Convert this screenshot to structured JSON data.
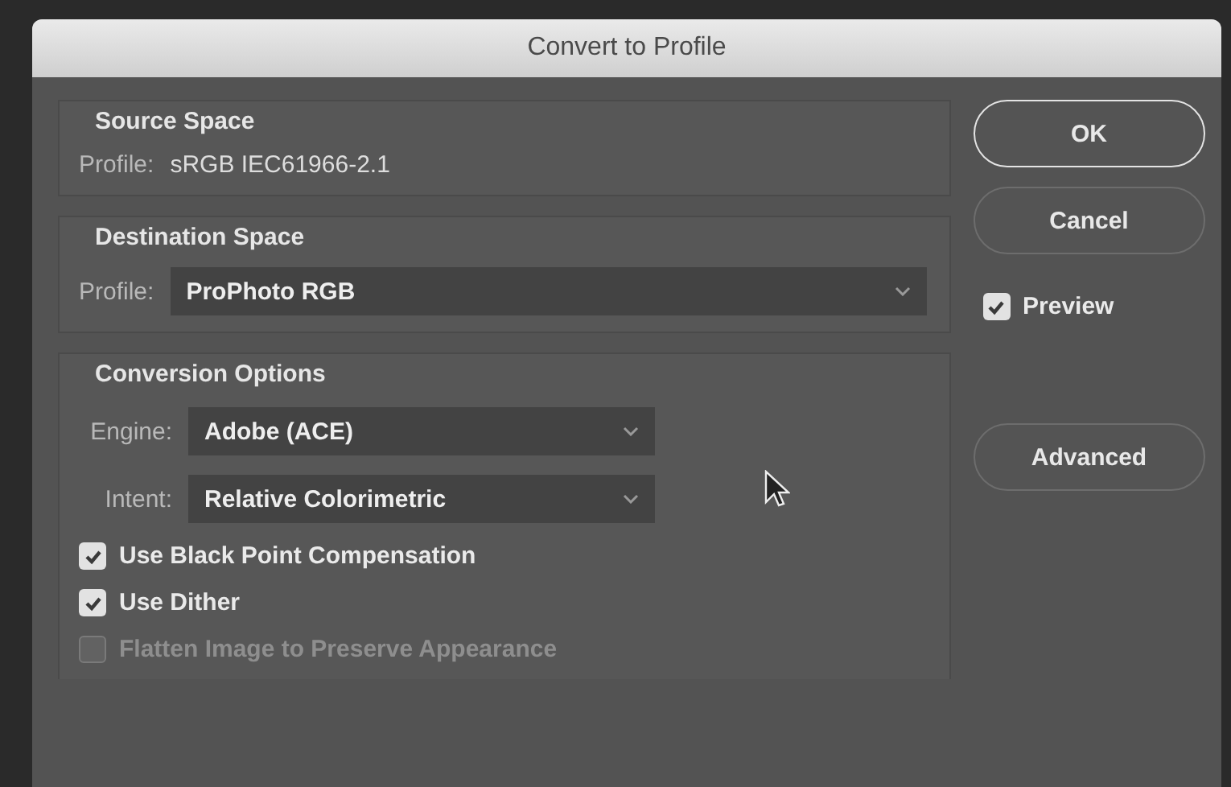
{
  "window": {
    "title": "Convert to Profile"
  },
  "source_space": {
    "heading": "Source Space",
    "profile_label": "Profile:",
    "profile_value": "sRGB IEC61966-2.1"
  },
  "destination_space": {
    "heading": "Destination Space",
    "profile_label": "Profile:",
    "profile_value": "ProPhoto RGB"
  },
  "conversion_options": {
    "heading": "Conversion Options",
    "fields": [
      {
        "label": "Engine:",
        "value": "Adobe (ACE)"
      },
      {
        "label": "Intent:",
        "value": "Relative Colorimetric"
      }
    ],
    "checkboxes": [
      {
        "label": "Use Black Point Compensation",
        "checked": true,
        "disabled": false
      },
      {
        "label": "Use Dither",
        "checked": true,
        "disabled": false
      },
      {
        "label": "Flatten Image to Preserve Appearance",
        "checked": false,
        "disabled": true
      }
    ]
  },
  "buttons": [
    {
      "label": "OK",
      "default": true
    },
    {
      "label": "Cancel",
      "default": false
    }
  ],
  "preview": {
    "label": "Preview",
    "checked": true
  },
  "advanced_button": {
    "label": "Advanced"
  }
}
